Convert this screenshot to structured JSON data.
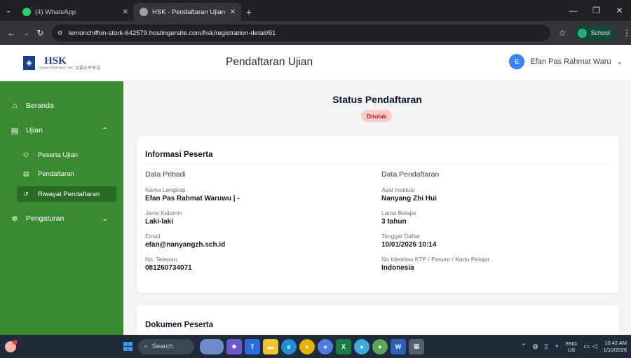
{
  "browser": {
    "tabs": [
      {
        "title": "(4) WhatsApp",
        "active": false
      },
      {
        "title": "HSK - Pendaftaran Ujian",
        "active": true
      }
    ],
    "url": "lemonchiffon-stork-642579.hostingersite.com/hsk/registration-detail/61",
    "profile_initial": "E",
    "profile_label": "School"
  },
  "logo": {
    "mark": "HSK",
    "sub": "Chinese Proficiency Test",
    "cn": "汉语水平考试"
  },
  "sidebar": {
    "items": [
      {
        "label": "Beranda",
        "icon": "home-icon"
      },
      {
        "label": "Ujian",
        "icon": "clipboard-icon"
      },
      {
        "label": "Peserta Ujian",
        "icon": "user-group-icon"
      },
      {
        "label": "Pendaftaran",
        "icon": "clipboard-icon"
      },
      {
        "label": "Riwayat Pendaftaran",
        "icon": "history-icon"
      },
      {
        "label": "Pengaturan",
        "icon": "gear-icon"
      }
    ]
  },
  "topbar": {
    "title": "Pendaftaran Ujian",
    "user_initial": "E",
    "user_name": "Efan Pas Rahmat Waru"
  },
  "status": {
    "title": "Status Pendaftaran",
    "badge": "Ditolak",
    "badge_color": "#fecaca"
  },
  "info": {
    "title": "Informasi Peserta",
    "personal": {
      "heading": "Data Pribadi",
      "fields": [
        {
          "label": "Nama Lengkap",
          "value": "Efan Pas Rahmat Waruwu | -"
        },
        {
          "label": "Jenis Kelamin",
          "value": "Laki-laki"
        },
        {
          "label": "Email",
          "value": "efan@nanyangzh.sch.id"
        },
        {
          "label": "No. Telepon",
          "value": "081260734071"
        }
      ]
    },
    "registration": {
      "heading": "Data Pendaftaran",
      "fields": [
        {
          "label": "Asal Institusi",
          "value": "Nanyang Zhi Hui"
        },
        {
          "label": "Lama Belajar",
          "value": "3 tahun"
        },
        {
          "label": "Tanggal Daftar",
          "value": "10/01/2026 10:14"
        },
        {
          "label": "No Identitas KTP / Paspor / Kartu Pelajar",
          "value": "Indonesia"
        }
      ]
    }
  },
  "documents": {
    "title": "Dokumen Peserta"
  },
  "taskbar": {
    "search_placeholder": "Search",
    "lang_top": "ENG",
    "lang_bottom": "US",
    "time": "10:42 AM",
    "date": "1/10/2026"
  },
  "colors": {
    "sidebar": "#3a8a32",
    "accent": "#3b82f6",
    "danger": "#b91c1c"
  }
}
